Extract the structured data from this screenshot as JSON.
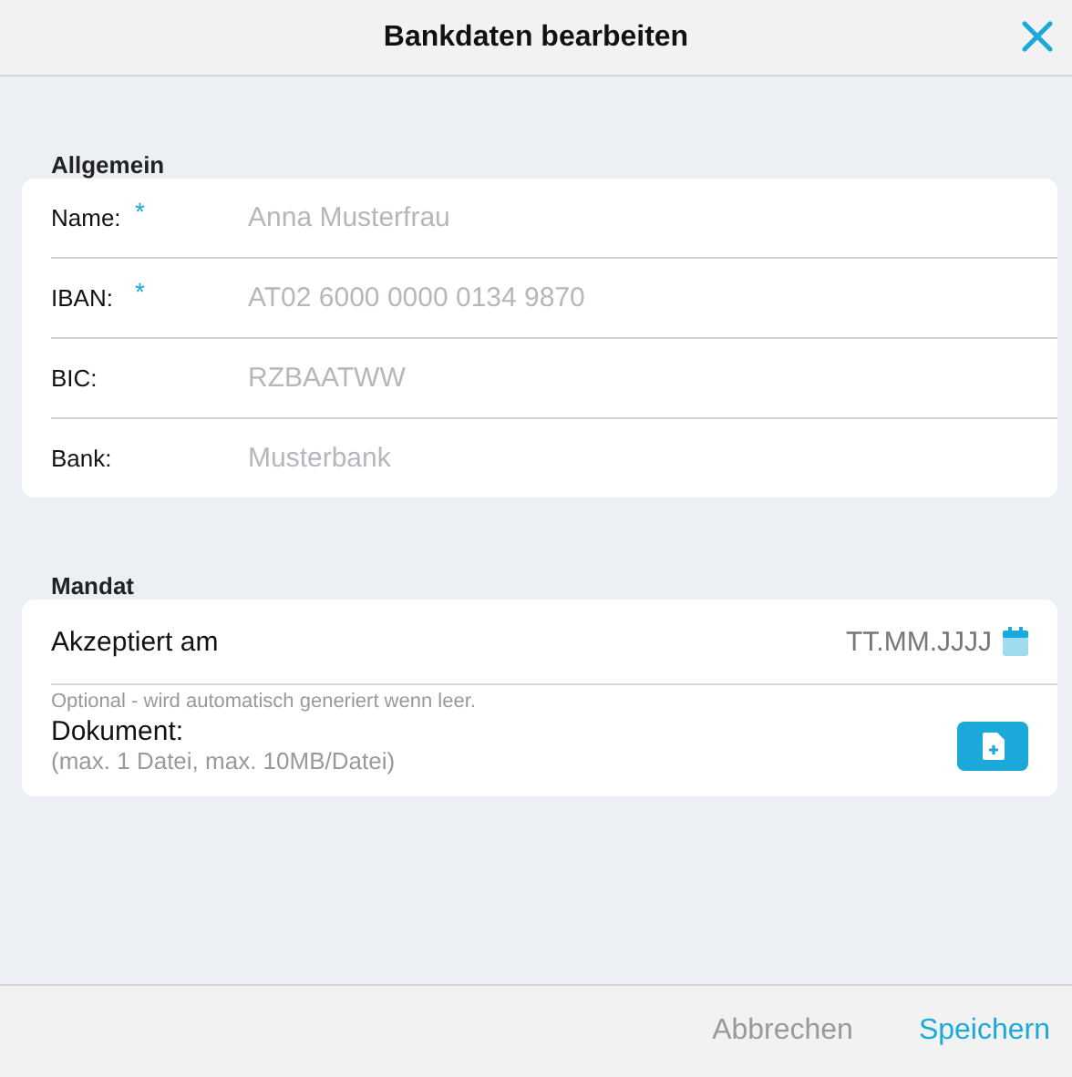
{
  "header": {
    "title": "Bankdaten bearbeiten"
  },
  "general": {
    "title": "Allgemein",
    "fields": [
      {
        "label": "Name:",
        "required_mark": "*",
        "placeholder": "Anna Musterfrau"
      },
      {
        "label": "IBAN:",
        "required_mark": "*",
        "placeholder": "AT02 6000 0000 0134 9870"
      },
      {
        "label": "BIC:",
        "placeholder": "RZBAATWW"
      },
      {
        "label": "Bank:",
        "placeholder": "Musterbank"
      }
    ]
  },
  "mandate": {
    "title": "Mandat",
    "date_label": "Akzeptiert am",
    "date_placeholder": "TT.MM.JJJJ",
    "hint": "Optional - wird automatisch generiert wenn leer.",
    "document_label": "Dokument:",
    "document_note": "(max. 1 Datei, max. 10MB/Datei)"
  },
  "footer": {
    "cancel": "Abbrechen",
    "save": "Speichern"
  }
}
